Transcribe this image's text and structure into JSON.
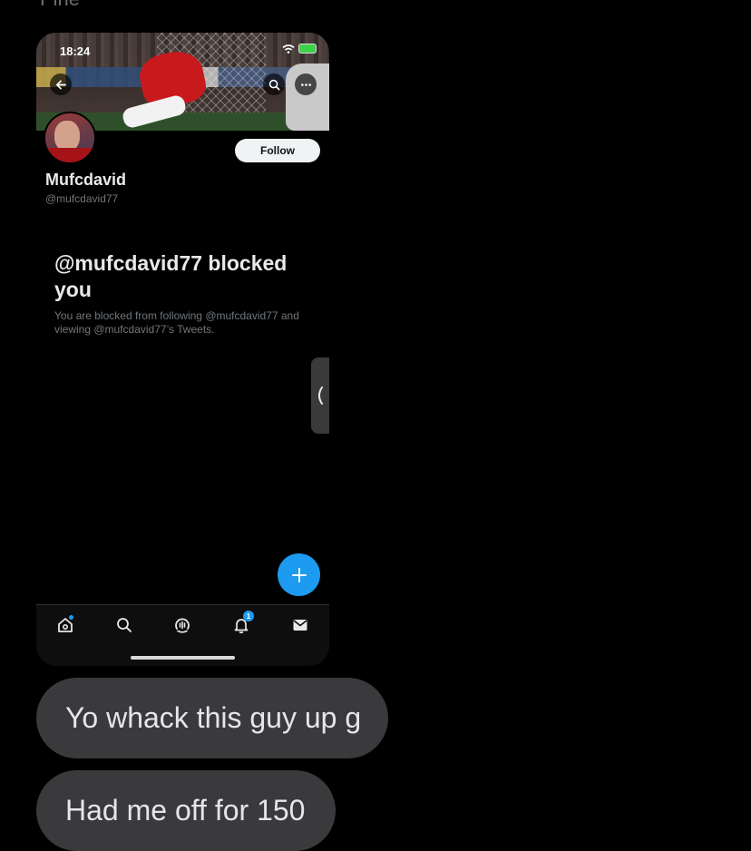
{
  "chat": {
    "top_partial_text": "Pine",
    "messages": [
      {
        "text": "Yo whack this guy up g"
      },
      {
        "text": "Had me off for 150"
      }
    ]
  },
  "phone": {
    "status_bar": {
      "time": "18:24"
    },
    "header": {
      "back_icon": "arrow-left-icon",
      "search_icon": "search-icon",
      "more_icon": "more-icon"
    },
    "profile": {
      "display_name": "Mufcdavid",
      "handle": "@mufcdavid77",
      "follow_label": "Follow"
    },
    "blocked": {
      "title": "@mufcdavid77 blocked you",
      "description": "You are blocked from following @mufcdavid77 and viewing @mufcdavid77’s Tweets."
    },
    "compose_icon": "plus-icon",
    "bottom_nav": {
      "items": [
        {
          "icon": "home-icon"
        },
        {
          "icon": "search-icon"
        },
        {
          "icon": "spaces-icon"
        },
        {
          "icon": "bell-icon",
          "badge": "1"
        },
        {
          "icon": "mail-icon"
        }
      ]
    },
    "colors": {
      "accent": "#1d9bf0",
      "background": "#000000",
      "bubble": "#3a3a3c"
    }
  }
}
